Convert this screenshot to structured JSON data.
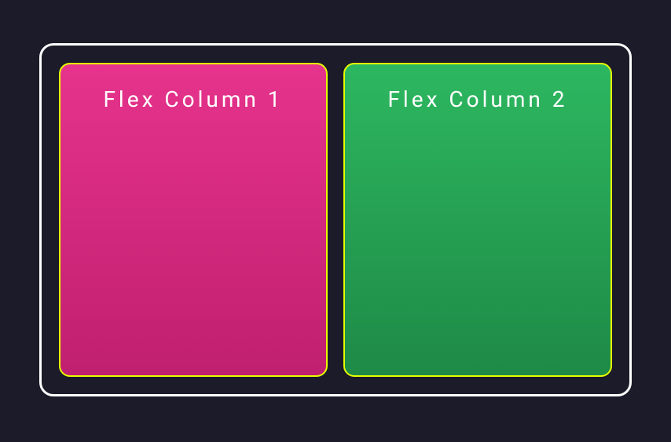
{
  "columns": [
    {
      "heading": "Flex Column 1"
    },
    {
      "heading": "Flex Column 2"
    }
  ]
}
